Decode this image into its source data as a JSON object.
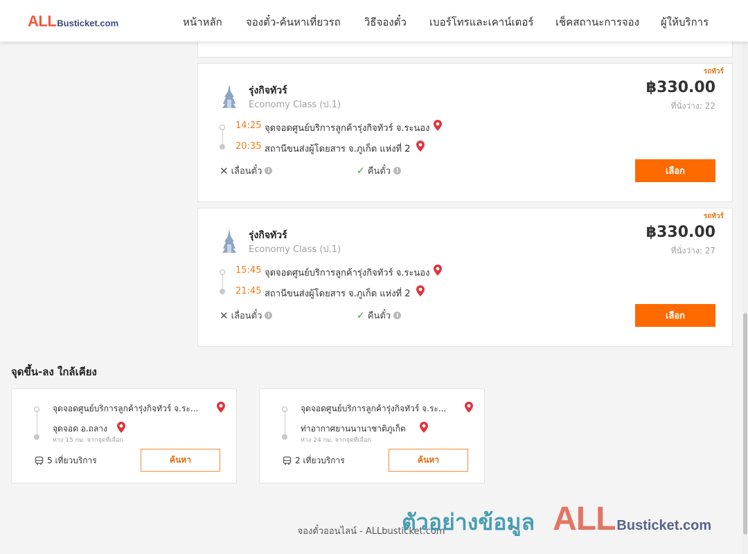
{
  "header": {
    "logo_big": "ALL",
    "logo_small": "Busticket.com",
    "nav": [
      "หน้าหลัก",
      "จองตั๋ว-ค้นหาเที่ยวรถ",
      "วิธีจองตั๋ว",
      "เบอร์โทรและเคาน์เตอร์",
      "เช็คสถานะการจอง",
      "ผู้ให้บริการ"
    ]
  },
  "trips": [
    {
      "tag": "รถทัวร์",
      "operator": "รุ่งกิจทัวร์",
      "class": "Economy Class (ป.1)",
      "price": "฿330.00",
      "seats": "ที่นั่งว่าง: 22",
      "depart_time": "14:25",
      "depart_stop": "จุดจอดศูนย์บริการลูกค้ารุ่งกิจทัวร์ จ.ระนอง",
      "arrive_time": "20:35",
      "arrive_stop": "สถานีขนส่งผู้โดยสาร จ.ภูเก็ต แห่งที่ 2",
      "reschedule": "เลื่อนตั๋ว",
      "refund": "คืนตั๋ว",
      "select_label": "เลือก"
    },
    {
      "tag": "รถทัวร์",
      "operator": "รุ่งกิจทัวร์",
      "class": "Economy Class (ป.1)",
      "price": "฿330.00",
      "seats": "ที่นั่งว่าง: 27",
      "depart_time": "15:45",
      "depart_stop": "จุดจอดศูนย์บริการลูกค้ารุ่งกิจทัวร์ จ.ระนอง",
      "arrive_time": "21:45",
      "arrive_stop": "สถานีขนส่งผู้โดยสาร จ.ภูเก็ต แห่งที่ 2",
      "reschedule": "เลื่อนตั๋ว",
      "refund": "คืนตั๋ว",
      "select_label": "เลือก"
    }
  ],
  "nearby": {
    "title": "จุดขึ้น-ลง ใกล้เคียง",
    "items": [
      {
        "from": "จุดจอดศูนย์บริการลูกค้ารุ่งกิจทัวร์ จ.ระ...",
        "to": "จุดจอด อ.ถลาง",
        "distance": "ห่าง 15 กม. จากจุดที่เลือก",
        "trips": "5 เที่ยวบริการ",
        "search_label": "ค้นหา"
      },
      {
        "from": "จุดจอดศูนย์บริการลูกค้ารุ่งกิจทัวร์ จ.ระ...",
        "to": "ท่าอากาศยานนานาชาติภูเก็ต",
        "distance": "ห่าง 24 กม. จากจุดที่เลือก",
        "trips": "2 เที่ยวบริการ",
        "search_label": "ค้นหา"
      }
    ]
  },
  "footer": "จองตั๋วออนไลน์ - ALLbusticket.com",
  "watermark": {
    "text": "ตัวอย่างข้อมูล",
    "logo_big": "ALL",
    "logo_small": "Busticket.com"
  },
  "colors": {
    "accent": "#ff6a00",
    "time": "#ef7d1a",
    "pin": "#e0333f"
  }
}
